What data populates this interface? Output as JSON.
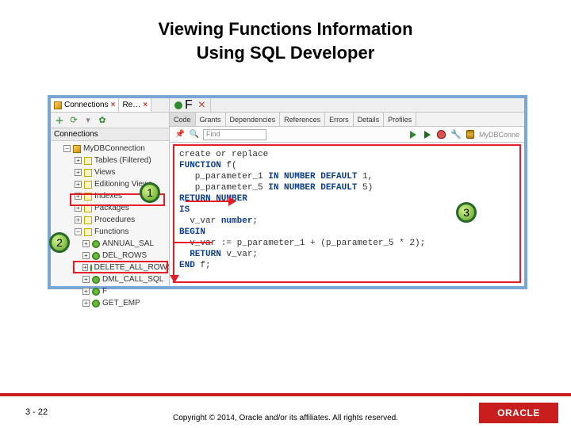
{
  "title_line1": "Viewing Functions Information",
  "title_line2": "Using SQL Developer",
  "left": {
    "tabs": [
      {
        "label": "Connections"
      },
      {
        "label": "Re…"
      }
    ],
    "section": "Connections",
    "conn": "MyDBConnection",
    "nodes": [
      "Tables (Filtered)",
      "Views",
      "Editioning Views",
      "Indexes",
      "Packages",
      "Procedures",
      "Functions"
    ],
    "functions": [
      "ANNUAL_SAL",
      "DEL_ROWS",
      "DELETE_ALL_ROWS",
      "DML_CALL_SQL",
      "F",
      "GET_EMP"
    ]
  },
  "right": {
    "tab": "F",
    "subtabs": [
      "Code",
      "Grants",
      "Dependencies",
      "References",
      "Errors",
      "Details",
      "Profiles"
    ],
    "find_placeholder": "Find",
    "conn_name": "MyDBConne",
    "code_lines": [
      "create or replace",
      "FUNCTION f(",
      "   p_parameter_1 IN NUMBER DEFAULT 1,",
      "   p_parameter_5 IN NUMBER DEFAULT 5)",
      "RETURN NUMBER",
      "IS",
      "  v_var number;",
      "BEGIN",
      "  v_var := p_parameter_1 + (p_parameter_5 * 2);",
      "  RETURN v_var;",
      "END f;"
    ]
  },
  "annotations": {
    "a1": "1",
    "a2": "2",
    "a3": "3"
  },
  "footer": {
    "page": "3 - 22",
    "copyright": "Copyright © 2014, Oracle and/or its affiliates. All rights reserved.",
    "brand": "ORACLE"
  }
}
